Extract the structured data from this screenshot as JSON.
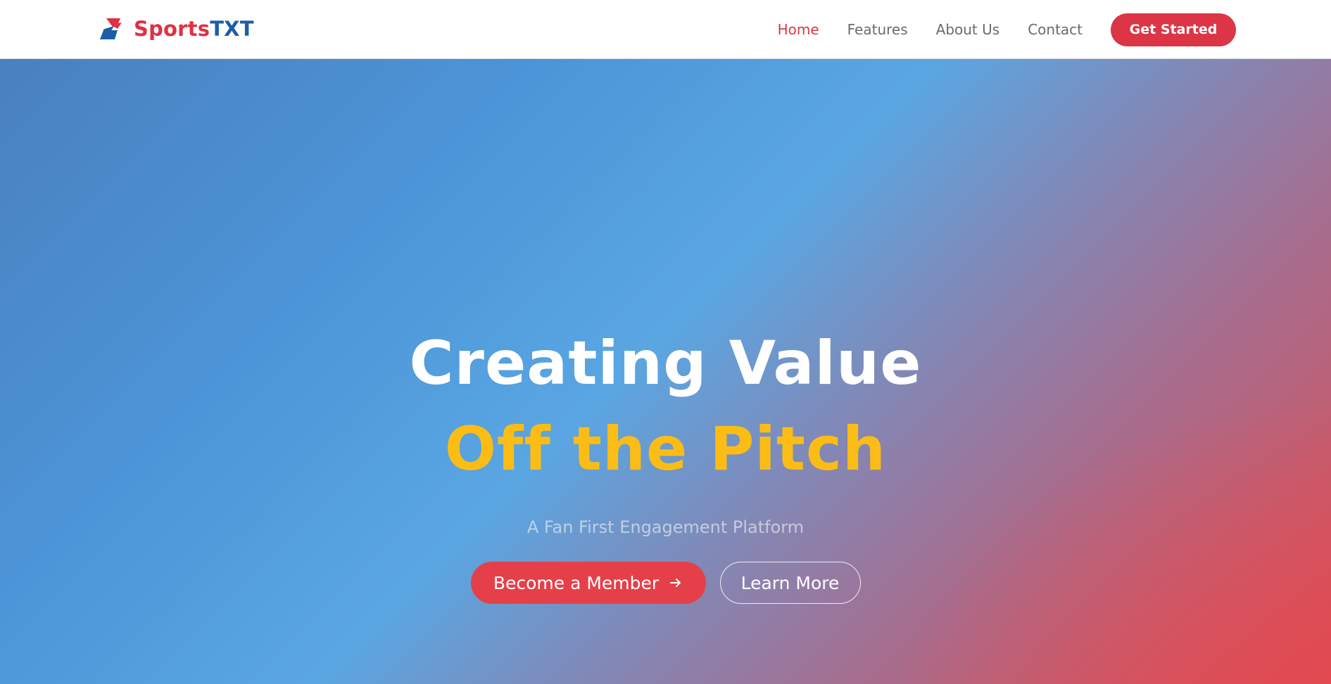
{
  "brand": {
    "name_part_a": "Sports",
    "name_part_b": "TXT",
    "logo_icon": "lightning-bolt-icon",
    "colors": {
      "red": "#e03043",
      "blue": "#1b5ea8"
    }
  },
  "nav": {
    "items": [
      {
        "label": "Home",
        "active": true
      },
      {
        "label": "Features",
        "active": false
      },
      {
        "label": "About Us",
        "active": false
      },
      {
        "label": "Contact",
        "active": false
      }
    ],
    "cta_label": "Get Started",
    "active_color": "#d63a43",
    "cta_color": "#dc3545"
  },
  "hero": {
    "title_line_1": "Creating Value",
    "title_line_2": "Off the Pitch",
    "subtitle": "A Fan First Engagement Platform",
    "primary_button": {
      "label": "Become a Member",
      "icon": "arrow-right-icon"
    },
    "secondary_button": {
      "label": "Learn More"
    },
    "accent_color": "#fbbd15",
    "gradient_colors": [
      "#4a80bf",
      "#5aa6e2",
      "#de4a52"
    ]
  }
}
